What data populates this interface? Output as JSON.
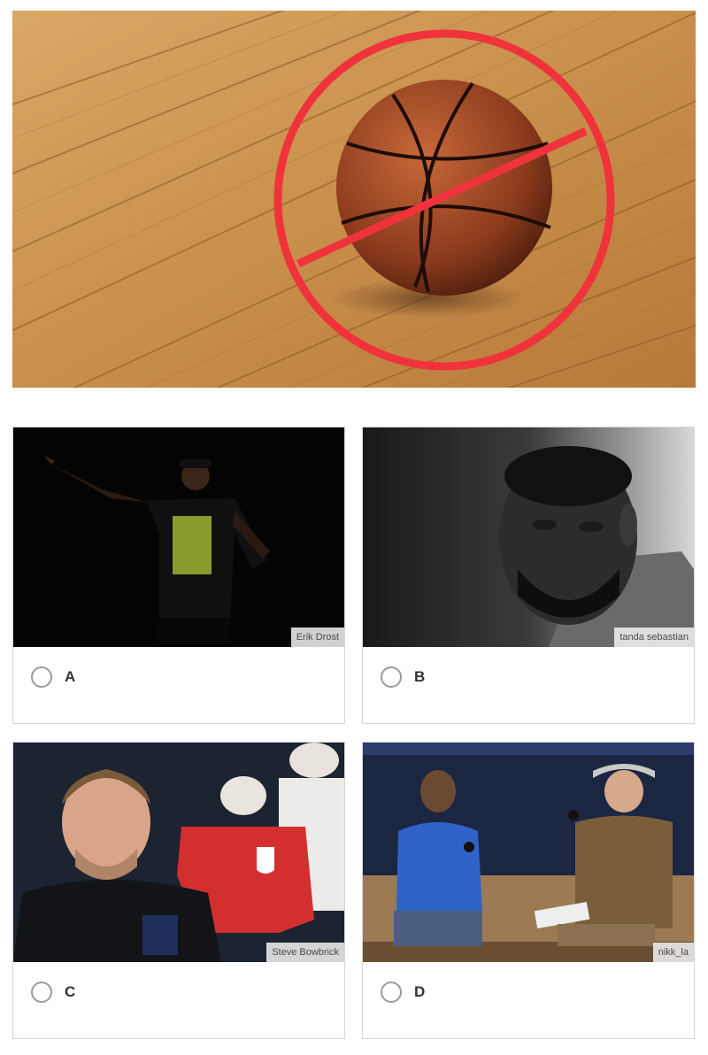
{
  "question": {
    "image_subject": "basketball",
    "overlay_icon": "prohibited-icon",
    "accent_color": "#f0333a"
  },
  "options": [
    {
      "letter": "A",
      "credit": "Erik Drost"
    },
    {
      "letter": "B",
      "credit": "tanda sebastian"
    },
    {
      "letter": "C",
      "credit": "Steve Bowbrick"
    },
    {
      "letter": "D",
      "credit": "nikk_la"
    }
  ]
}
